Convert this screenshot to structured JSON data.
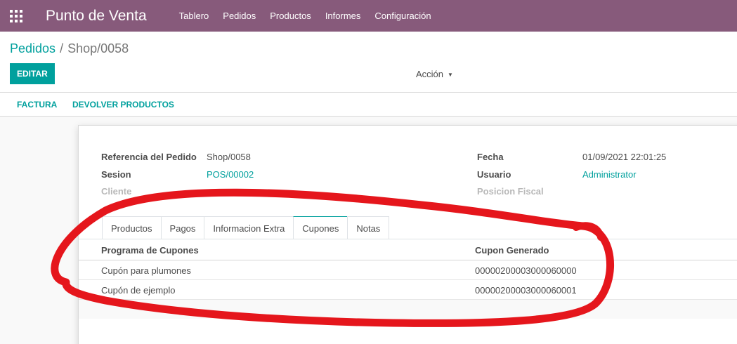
{
  "navbar": {
    "brand": "Punto de Venta",
    "menu": [
      "Tablero",
      "Pedidos",
      "Productos",
      "Informes",
      "Configuración"
    ],
    "color": "#875a7b"
  },
  "breadcrumb": {
    "parent": "Pedidos",
    "separator": "/",
    "current": "Shop/0058"
  },
  "control": {
    "edit_label": "EDITAR",
    "action_label": "Acción"
  },
  "statusbar": {
    "invoice_label": "FACTURA",
    "return_label": "DEVOLVER PRODUCTOS"
  },
  "form": {
    "order_ref_label": "Referencia del Pedido",
    "order_ref_value": "Shop/0058",
    "session_label": "Sesion",
    "session_value": "POS/00002",
    "customer_label": "Cliente",
    "date_label": "Fecha",
    "date_value": "01/09/2021 22:01:25",
    "user_label": "Usuario",
    "user_value": "Administrator",
    "fiscal_label": "Posicion Fiscal"
  },
  "tabs": [
    "Productos",
    "Pagos",
    "Informacion Extra",
    "Cupones",
    "Notas"
  ],
  "active_tab": "Cupones",
  "coupons_table": {
    "headers": [
      "Programa de Cupones",
      "Cupon Generado"
    ],
    "rows": [
      [
        "Cupón para plumones",
        "00000200003000060000"
      ],
      [
        "Cupón de ejemplo",
        "00000200003000060001"
      ]
    ]
  },
  "colors": {
    "accent": "#00a09d",
    "annotation": "#e5161c"
  }
}
